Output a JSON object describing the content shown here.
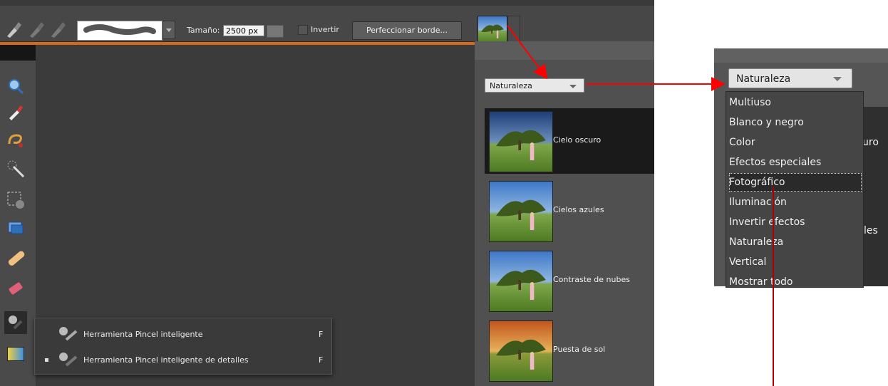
{
  "options_bar": {
    "size_label": "Tamaño:",
    "size_value": "2500 px",
    "invert_label": "Invertir",
    "refine_button": "Perfeccionar borde..."
  },
  "effects_panel": {
    "category": "Naturaleza",
    "effects": [
      {
        "label": "Cielo oscuro"
      },
      {
        "label": "Cielos azules"
      },
      {
        "label": "Contraste de nubes"
      },
      {
        "label": "Puesta de sol"
      }
    ]
  },
  "tool_flyout": {
    "items": [
      {
        "label": "Herramienta Pincel inteligente",
        "shortcut": "F"
      },
      {
        "label": "Herramienta Pincel inteligente de detalles",
        "shortcut": "F"
      }
    ]
  },
  "zoom_dropdown": {
    "selected": "Naturaleza",
    "options": [
      "Multiuso",
      "Blanco y negro",
      "Color",
      "Efectos especiales",
      "Fotográfico",
      "Iluminación",
      "Invertir efectos",
      "Naturaleza",
      "Vertical",
      "Mostrar todo"
    ],
    "highlighted": "Fotográfico",
    "behind_text_1": "uro",
    "behind_text_2": "les"
  },
  "colors": {
    "arrow": "#ff0000",
    "dark_red_line": "#b00000",
    "ui_bg": "#3a3a3a"
  }
}
